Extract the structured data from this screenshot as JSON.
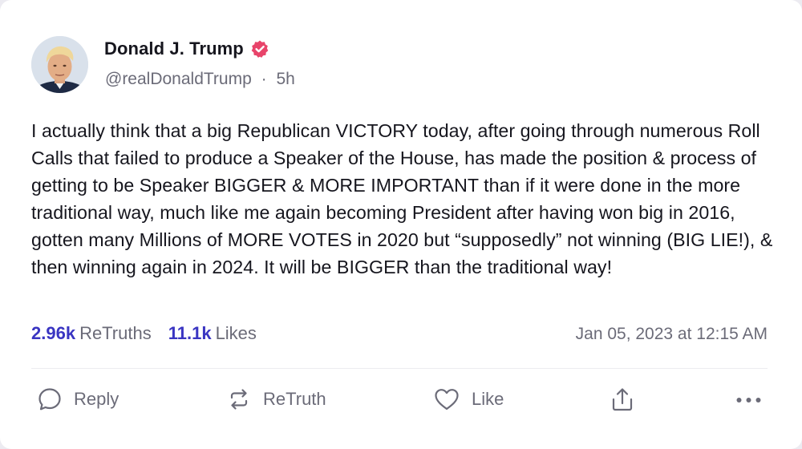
{
  "post": {
    "author_name": "Donald J. Trump",
    "handle": "@realDonaldTrump",
    "separator": "·",
    "age": "5h",
    "body": "I actually think that a big Republican VICTORY today, after going through numerous Roll Calls that failed to produce a Speaker of the House, has made the position & process of getting to be Speaker BIGGER & MORE IMPORTANT than if it were done in the more traditional way, much like me again becoming President after having won big in 2016, gotten many Millions of MORE VOTES in 2020 but “supposedly” not winning (BIG LIE!), & then winning again in 2024. It will be BIGGER than the traditional way!",
    "retruths_count": "2.96k",
    "retruths_label": "ReTruths",
    "likes_count": "11.1k",
    "likes_label": "Likes",
    "timestamp": "Jan 05, 2023 at 12:15 AM"
  },
  "actions": {
    "reply_label": "Reply",
    "retruth_label": "ReTruth",
    "like_label": "Like"
  },
  "icons": {
    "verified": "verified-badge-icon",
    "reply": "speech-bubble-icon",
    "retruth": "repost-arrows-icon",
    "like": "heart-icon",
    "share": "share-upload-icon",
    "more": "more-dots-icon"
  },
  "colors": {
    "accent": "#3a35c2",
    "verified": "#e8446a",
    "muted": "#6b6b78",
    "text": "#16161e",
    "background": "#ecebf1",
    "card": "#ffffff"
  }
}
